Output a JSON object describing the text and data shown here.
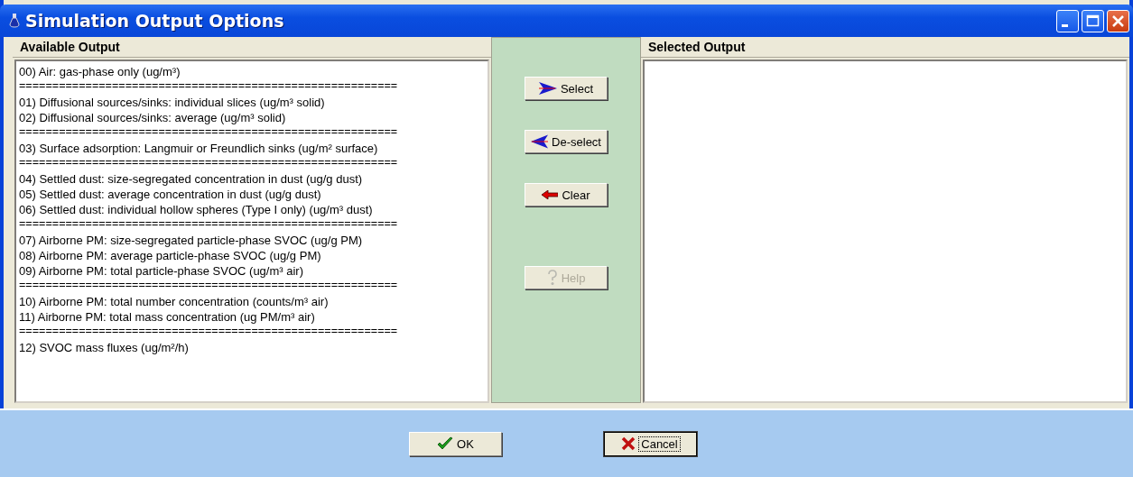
{
  "window": {
    "title": "Simulation Output Options"
  },
  "available_output": {
    "title": "Available Output",
    "items": [
      {
        "kind": "option",
        "text": "00) Air: gas-phase only (ug/m³)"
      },
      {
        "kind": "separator",
        "text": "========================================================="
      },
      {
        "kind": "option",
        "text": "01) Diffusional sources/sinks: individual slices (ug/m³ solid)"
      },
      {
        "kind": "option",
        "text": "02) Diffusional sources/sinks: average (ug/m³ solid)"
      },
      {
        "kind": "separator",
        "text": "========================================================="
      },
      {
        "kind": "option",
        "text": "03) Surface adsorption: Langmuir or Freundlich sinks (ug/m² surface)"
      },
      {
        "kind": "separator",
        "text": "========================================================="
      },
      {
        "kind": "option",
        "text": "04) Settled dust: size-segregated concentration in dust (ug/g dust)"
      },
      {
        "kind": "option",
        "text": "05) Settled dust: average concentration in dust (ug/g dust)"
      },
      {
        "kind": "option",
        "text": "06) Settled dust: individual hollow spheres (Type I only) (ug/m³ dust)"
      },
      {
        "kind": "separator",
        "text": "========================================================="
      },
      {
        "kind": "option",
        "text": "07) Airborne PM: size-segregated particle-phase SVOC (ug/g PM)"
      },
      {
        "kind": "option",
        "text": "08) Airborne PM: average particle-phase SVOC (ug/g PM)"
      },
      {
        "kind": "option",
        "text": "09) Airborne PM: total particle-phase SVOC (ug/m³ air)"
      },
      {
        "kind": "separator",
        "text": "========================================================="
      },
      {
        "kind": "option",
        "text": "10) Airborne PM: total number concentration (counts/m³ air)"
      },
      {
        "kind": "option",
        "text": "11) Airborne PM: total mass concentration (ug PM/m³ air)"
      },
      {
        "kind": "separator",
        "text": "========================================================="
      },
      {
        "kind": "option",
        "text": "12) SVOC mass fluxes (ug/m²/h)"
      }
    ]
  },
  "actions": [
    {
      "kind": "select",
      "label": "Select",
      "disabled": false
    },
    {
      "kind": "deselect",
      "label": "De-select",
      "disabled": false
    },
    {
      "kind": "clear",
      "label": "Clear",
      "disabled": false
    },
    {
      "kind": "help",
      "label": "Help",
      "disabled": true
    }
  ],
  "selected_output": {
    "title": "Selected Output"
  },
  "buttons": [
    {
      "kind": "ok",
      "label": "OK",
      "focused": false
    },
    {
      "kind": "cancel",
      "label": "Cancel",
      "focused": true
    }
  ]
}
